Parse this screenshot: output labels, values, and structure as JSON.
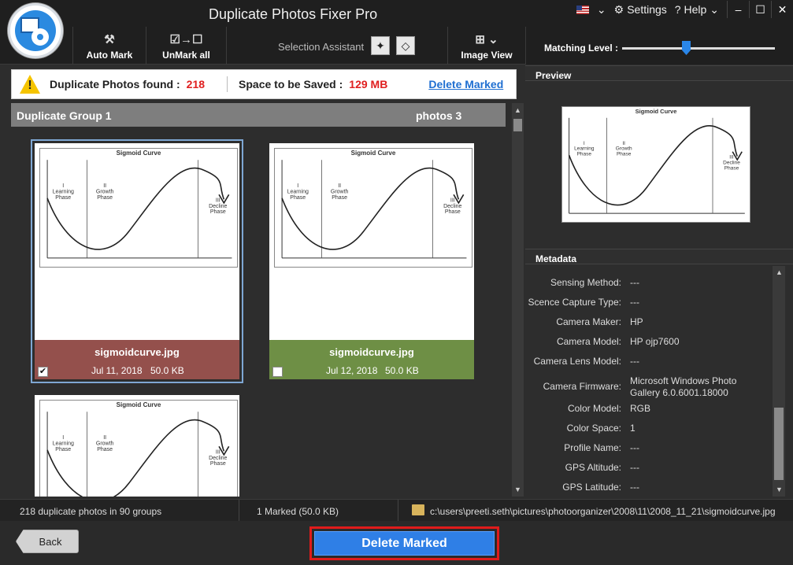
{
  "app": {
    "title": "Duplicate Photos Fixer Pro"
  },
  "titlebar": {
    "settings": "Settings",
    "help": "? Help"
  },
  "toolbar": {
    "auto_mark": "Auto Mark",
    "unmark_all": "UnMark all",
    "selection_assistant": "Selection Assistant",
    "image_view": "Image View"
  },
  "matching": {
    "label": "Matching Level :",
    "level": 0.5
  },
  "info": {
    "found_label": "Duplicate Photos found :",
    "found_value": "218",
    "space_label": "Space to be Saved :",
    "space_value": "129 MB",
    "delete_link": "Delete Marked"
  },
  "group": {
    "name": "Duplicate Group 1",
    "count": "photos 3"
  },
  "thumbnail": {
    "title": "Sigmoid Curve",
    "phase1": [
      "I",
      "Learning",
      "Phase"
    ],
    "phase2": [
      "II",
      "Growth",
      "Phase"
    ],
    "phase3": [
      "III",
      "Decline",
      "Phase"
    ]
  },
  "photos": [
    {
      "file": "sigmoidcurve.jpg",
      "date": "Jul 11, 2018",
      "size": "50.0 KB",
      "checked": true,
      "color": "#94504c"
    },
    {
      "file": "sigmoidcurve.jpg",
      "date": "Jul 12, 2018",
      "size": "50.0 KB",
      "checked": false,
      "color": "#6e8f45"
    },
    {
      "file": "",
      "date": "",
      "size": "",
      "checked": false,
      "color": "#ffffff"
    }
  ],
  "panels": {
    "preview": "Preview",
    "metadata": "Metadata"
  },
  "metadata": [
    {
      "key": "Sensing Method:",
      "value": "---"
    },
    {
      "key": "Scence Capture Type:",
      "value": "---"
    },
    {
      "key": "Camera Maker:",
      "value": "HP"
    },
    {
      "key": "Camera Model:",
      "value": "HP ojp7600"
    },
    {
      "key": "Camera Lens Model:",
      "value": "---"
    },
    {
      "key": "Camera Firmware:",
      "value": "Microsoft Windows Photo Gallery 6.0.6001.18000"
    },
    {
      "key": "Color Model:",
      "value": "RGB"
    },
    {
      "key": "Color Space:",
      "value": "1"
    },
    {
      "key": "Profile Name:",
      "value": "---"
    },
    {
      "key": "GPS Altitude:",
      "value": "---"
    },
    {
      "key": "GPS Latitude:",
      "value": "---"
    }
  ],
  "status": {
    "groups": "218 duplicate photos in 90 groups",
    "marked": "1 Marked (50.0 KB)",
    "path": "c:\\users\\preeti.seth\\pictures\\photoorganizer\\2008\\11\\2008_11_21\\sigmoidcurve.jpg"
  },
  "buttons": {
    "back": "Back",
    "delete_marked": "Delete Marked"
  }
}
